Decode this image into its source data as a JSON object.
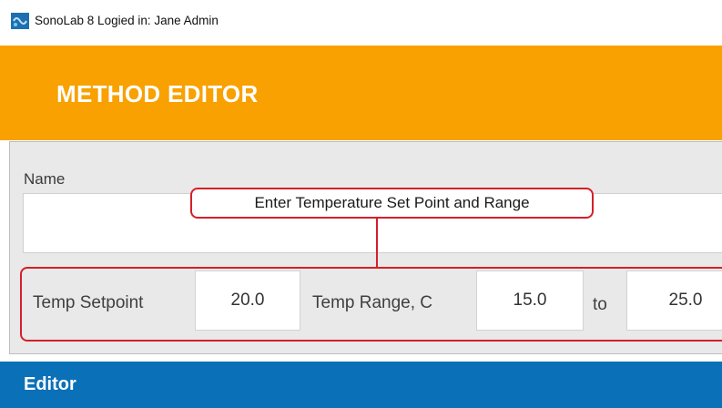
{
  "window": {
    "title": "SonoLab 8 Logied in: Jane Admin",
    "icon": "sonolab-app-icon"
  },
  "header": {
    "title": "METHOD EDITOR",
    "color": "#f8a100"
  },
  "form": {
    "name_label": "Name",
    "name_value": "",
    "temp_setpoint_label": "Temp Setpoint",
    "temp_setpoint_value": "20.0",
    "temp_range_label": "Temp Range, C",
    "temp_range_low": "15.0",
    "to_label": "to",
    "temp_range_high": "25.0"
  },
  "editor": {
    "title": "Editor",
    "color": "#0a70b8"
  },
  "annotation": {
    "callout_text": "Enter Temperature Set Point and Range",
    "color": "#d41f2a"
  }
}
